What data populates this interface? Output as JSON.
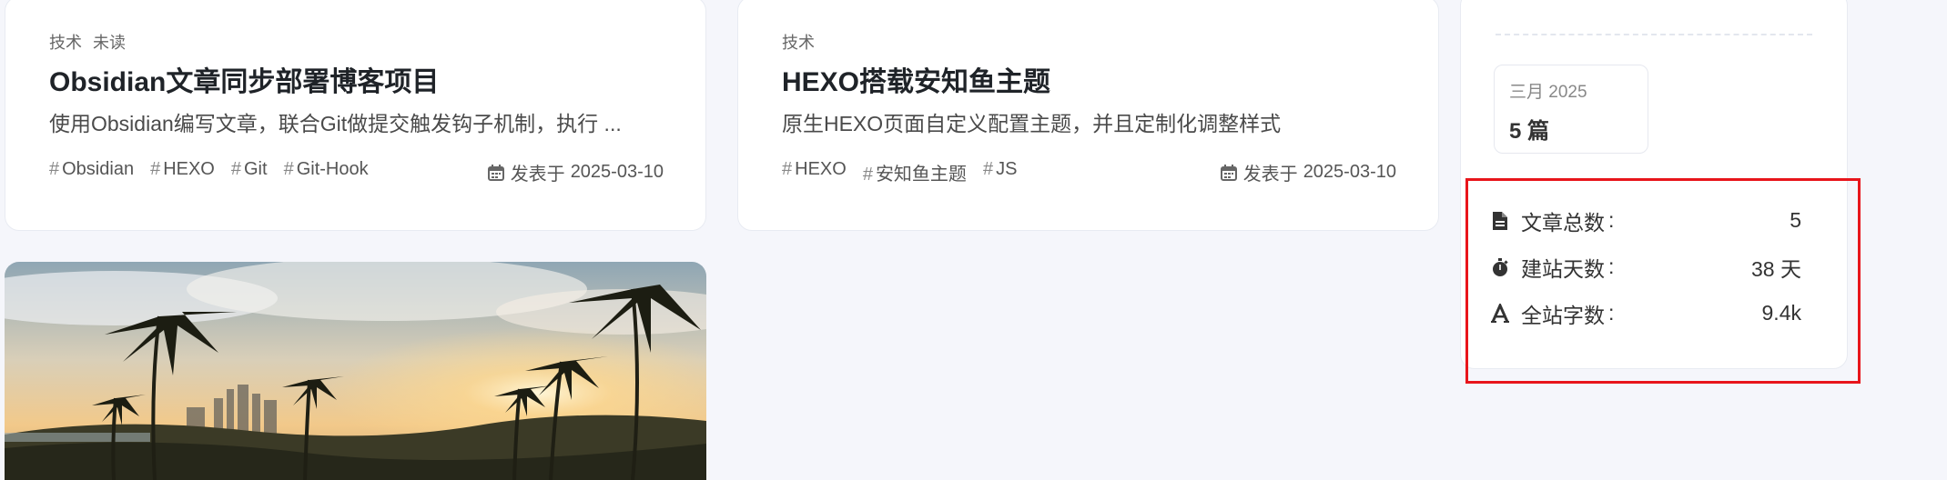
{
  "posts": [
    {
      "categories": [
        "技术",
        "未读"
      ],
      "title": "Obsidian文章同步部署博客项目",
      "excerpt": "使用Obsidian编写文章，联合Git做提交触发钩子机制，执行 ...",
      "tags": [
        "Obsidian",
        "HEXO",
        "Git",
        "Git-Hook"
      ],
      "date_prefix": "发表于",
      "date": "2025-03-10"
    },
    {
      "categories": [
        "技术"
      ],
      "title": "HEXO搭载安知鱼主题",
      "excerpt": "原生HEXO页面自定义配置主题，并且定制化调整样式",
      "tags": [
        "HEXO",
        "安知鱼主题",
        "JS"
      ],
      "date_prefix": "发表于",
      "date": "2025-03-10"
    }
  ],
  "tag_symbol": "#",
  "sidebar": {
    "archive": {
      "month": "三月 2025",
      "count": "5 篇"
    },
    "stats": [
      {
        "icon": "file-icon",
        "label": "文章总数",
        "colon": ":",
        "value": "5"
      },
      {
        "icon": "stopwatch-icon",
        "label": "建站天数",
        "colon": ":",
        "value": "38 天"
      },
      {
        "icon": "font-icon",
        "label": "全站字数",
        "colon": ":",
        "value": "9.4k"
      }
    ]
  },
  "colors": {
    "highlight": "#e8151b",
    "background": "#f5f6fb"
  }
}
